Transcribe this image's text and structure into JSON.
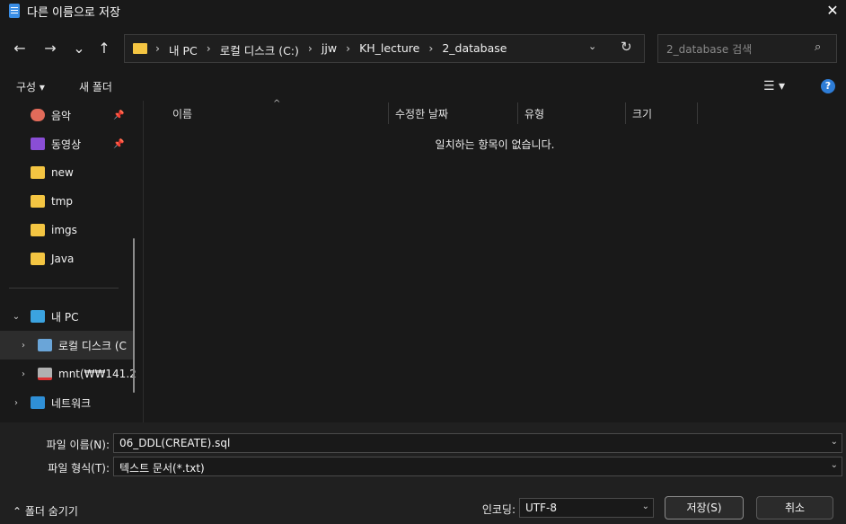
{
  "window": {
    "title": "다른 이름으로 저장",
    "close": "✕"
  },
  "nav": {
    "back": "←",
    "forward": "→",
    "recent": "⌄",
    "up": "↑"
  },
  "address": {
    "breadcrumb": [
      "내 PC",
      "로컬 디스크 (C:)",
      "jjw",
      "KH_lecture",
      "2_database"
    ],
    "separator": "›",
    "dropdown": "⌄",
    "refresh": "↻"
  },
  "search": {
    "placeholder": "2_database 검색",
    "icon": "⌕"
  },
  "toolbar": {
    "organize": "구성 ▾",
    "new_folder": "새 폴더",
    "view": "☰ ▾",
    "help": "?"
  },
  "sidebar": {
    "items": [
      {
        "label": "음악",
        "icon": "music-icon",
        "pinned": true
      },
      {
        "label": "동영상",
        "icon": "video-icon",
        "pinned": true
      },
      {
        "label": "new",
        "icon": "folder-icon"
      },
      {
        "label": "tmp",
        "icon": "folder-icon"
      },
      {
        "label": "imgs",
        "icon": "folder-icon"
      },
      {
        "label": "Java",
        "icon": "folder-icon"
      }
    ],
    "pc": {
      "label": "내 PC",
      "expanded": true
    },
    "drives": [
      {
        "label": "로컬 디스크 (C",
        "selected": true
      },
      {
        "label": "mnt(₩₩141.2"
      }
    ],
    "network": {
      "label": "네트워크"
    },
    "pin_glyph": "📌"
  },
  "list": {
    "columns": [
      "이름",
      "수정한 날짜",
      "유형",
      "크기"
    ],
    "sort_glyph": "^",
    "empty_message": "일치하는 항목이 없습니다."
  },
  "form": {
    "filename_label": "파일 이름(N):",
    "filename_value": "06_DDL(CREATE).sql",
    "filetype_label": "파일 형식(T):",
    "filetype_value": "텍스트 문서(*.txt)",
    "encoding_label": "인코딩:",
    "encoding_value": "UTF-8",
    "hide_folders": "⌃ 폴더 숨기기",
    "save_button": "저장(S)",
    "cancel_button": "취소"
  },
  "colors": {
    "background": "#191919",
    "bottom_panel": "#202020",
    "accent": "#2e7dd7",
    "folder": "#f4c542"
  }
}
